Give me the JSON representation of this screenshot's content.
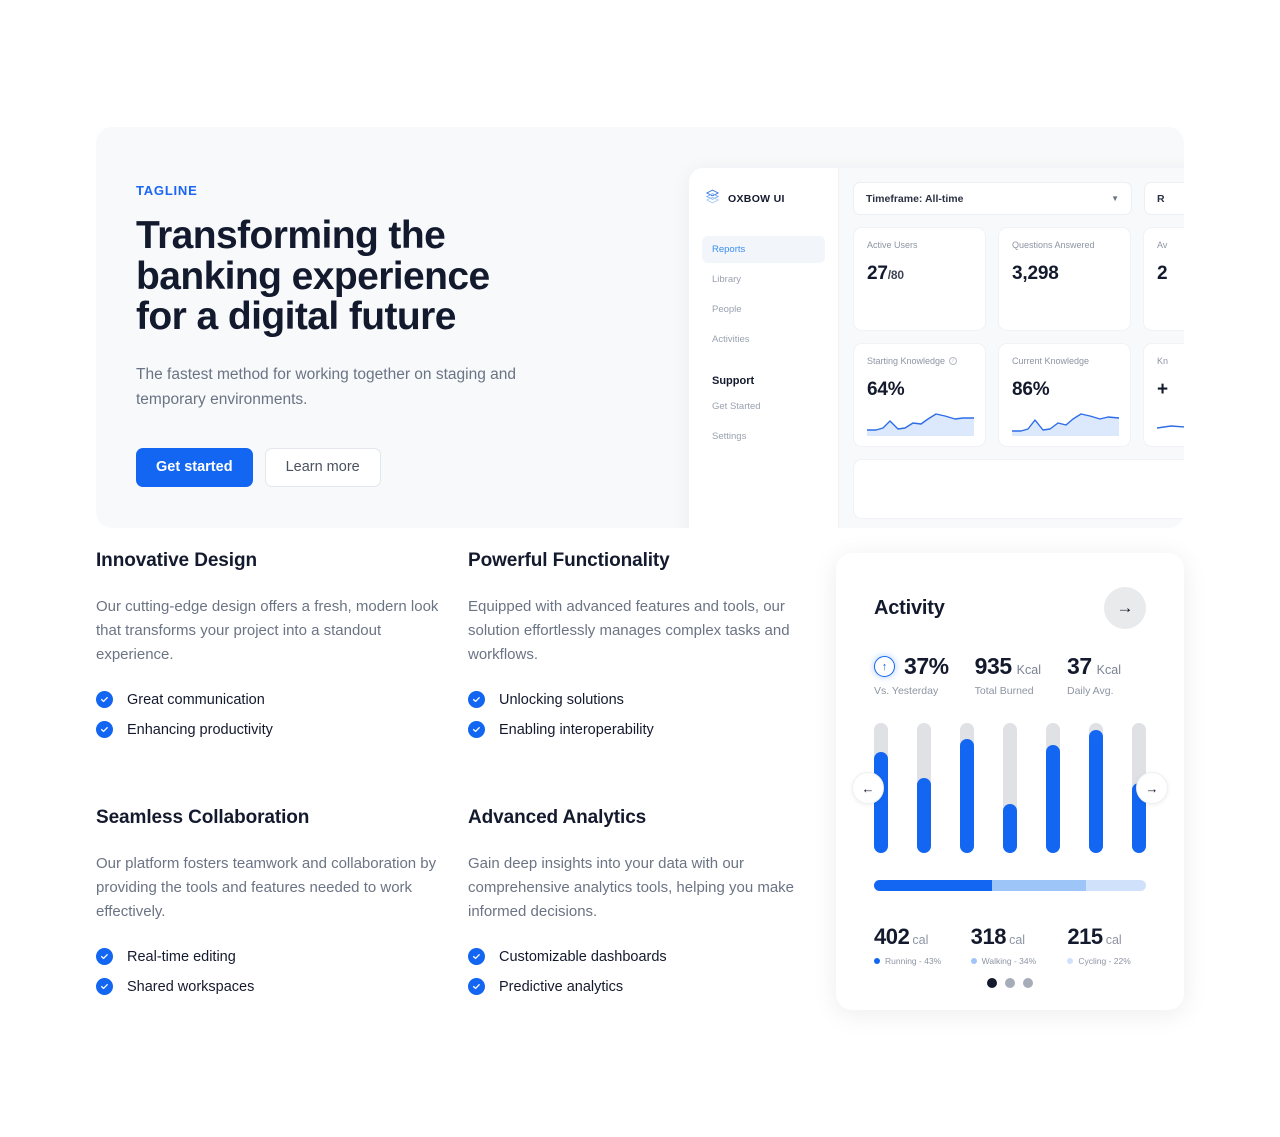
{
  "hero": {
    "tagline": "TAGLINE",
    "title_lines": [
      "Transforming the",
      "banking experience",
      "for a digital future"
    ],
    "subtitle": "The fastest method for working together on staging and temporary environments.",
    "primary_button": "Get started",
    "secondary_button": "Learn more",
    "accent_color": "#1266f1",
    "panel_bg": "#f7f9fb"
  },
  "dashboard": {
    "brand": "OXBOW UI",
    "nav": [
      {
        "label": "Reports",
        "active": true
      },
      {
        "label": "Library",
        "active": false
      },
      {
        "label": "People",
        "active": false
      },
      {
        "label": "Activities",
        "active": false
      }
    ],
    "section_heading": "Support",
    "nav_support": [
      {
        "label": "Get Started"
      },
      {
        "label": "Settings"
      }
    ],
    "toolbar": {
      "timeframe_select": "Timeframe: All-time",
      "second_select": "R",
      "caret_icon": "chevron-down-icon"
    },
    "cards_row1": [
      {
        "label": "Active Users",
        "value": "27",
        "suffix": "/80",
        "info": false
      },
      {
        "label": "Questions Answered",
        "value": "3,298",
        "suffix": "",
        "info": false
      },
      {
        "label": "Av",
        "value": "2",
        "suffix": "",
        "info": false
      }
    ],
    "cards_row2": [
      {
        "label": "Starting Knowledge",
        "value": "64%",
        "info": true,
        "spark": true
      },
      {
        "label": "Current Knowledge",
        "value": "86%",
        "info": false,
        "spark": true
      },
      {
        "label": "Kn",
        "value": "+",
        "info": false,
        "spark": true
      }
    ]
  },
  "features": [
    {
      "title": "Innovative Design",
      "desc": "Our cutting-edge design offers a fresh, modern look that transforms your project into a standout experience.",
      "items": [
        "Great communication",
        "Enhancing productivity"
      ]
    },
    {
      "title": "Powerful Functionality",
      "desc": "Equipped with advanced features and tools, our solution effortlessly manages complex tasks and workflows.",
      "items": [
        "Unlocking solutions",
        "Enabling interoperability"
      ]
    },
    {
      "title": "Seamless Collaboration",
      "desc": "Our platform fosters teamwork and collaboration by providing the tools and features needed to work effectively.",
      "items": [
        "Real-time editing",
        "Shared workspaces"
      ]
    },
    {
      "title": "Advanced Analytics",
      "desc": "Gain deep insights into your data with our comprehensive analytics tools, helping you make informed decisions.",
      "items": [
        "Customizable dashboards",
        "Predictive analytics"
      ]
    }
  ],
  "activity": {
    "title": "Activity",
    "next_icon": "arrow-right-icon",
    "prev_icon": "arrow-left-icon",
    "stats": [
      {
        "value": "37%",
        "unit": "",
        "caption": "Vs. Yesterday",
        "trend_icon": "arrow-up-circle-icon"
      },
      {
        "value": "935",
        "unit": "Kcal",
        "caption": "Total Burned"
      },
      {
        "value": "37",
        "unit": "Kcal",
        "caption": "Daily Avg."
      }
    ],
    "legend": [
      {
        "value": "402",
        "unit": "cal",
        "label": "Running - 43%",
        "color": "#1266f1"
      },
      {
        "value": "318",
        "unit": "cal",
        "label": "Walking - 34%",
        "color": "#9ec5f7"
      },
      {
        "value": "215",
        "unit": "cal",
        "label": "Cycling - 22%",
        "color": "#cfe1fb"
      }
    ],
    "pagination": {
      "count": 3,
      "active": 0
    }
  },
  "chart_data": [
    {
      "type": "bar",
      "title": "Activity weekly bars",
      "categories": [
        "1",
        "2",
        "3",
        "4",
        "5",
        "6",
        "7"
      ],
      "values": [
        78,
        58,
        88,
        38,
        83,
        95,
        54
      ],
      "ylim": [
        0,
        100
      ],
      "ylabel": "",
      "xlabel": "",
      "grid": false,
      "track_color": "#dfe1e4",
      "fill_color": "#1266f1"
    },
    {
      "type": "pie",
      "title": "Calories by activity",
      "categories": [
        "Running",
        "Walking",
        "Cycling"
      ],
      "values": [
        43,
        34,
        22
      ],
      "value_labels": [
        "402 cal",
        "318 cal",
        "215 cal"
      ],
      "colors": [
        "#1266f1",
        "#9ec5f7",
        "#cfe1fb"
      ],
      "legend": "bottom"
    },
    {
      "type": "area",
      "title": "Starting Knowledge",
      "x": [
        0,
        1,
        2,
        3,
        4,
        5,
        6,
        7,
        8,
        9,
        10,
        11,
        12
      ],
      "values": [
        18,
        18,
        20,
        38,
        20,
        22,
        32,
        30,
        44,
        62,
        58,
        50,
        52
      ],
      "ylim": [
        0,
        100
      ],
      "line_color": "#2c6de8",
      "fill_color": "#dbe7fb"
    },
    {
      "type": "area",
      "title": "Current Knowledge",
      "x": [
        0,
        1,
        2,
        3,
        4,
        5,
        6,
        7,
        8,
        9,
        10,
        11,
        12
      ],
      "values": [
        16,
        16,
        20,
        40,
        22,
        24,
        34,
        30,
        46,
        64,
        56,
        48,
        54
      ],
      "ylim": [
        0,
        100
      ],
      "line_color": "#2c6de8",
      "fill_color": "#dbe7fb"
    }
  ]
}
